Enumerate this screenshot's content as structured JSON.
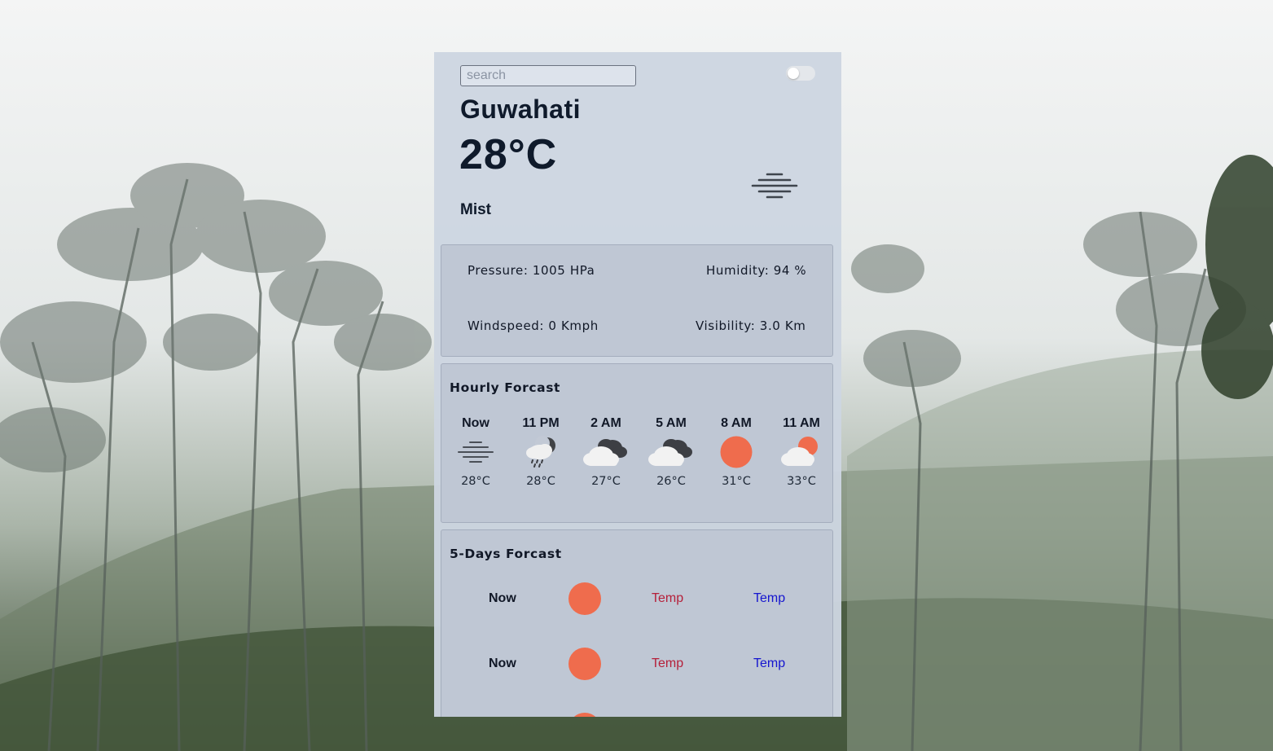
{
  "search": {
    "placeholder": "search"
  },
  "current": {
    "city": "Guwahati",
    "temperature": "28°C",
    "condition": "Mist",
    "icon": "mist-icon"
  },
  "details": {
    "pressure": "Pressure: 1005 HPa",
    "humidity": "Humidity: 94 %",
    "windspeed": "Windspeed: 0 Kmph",
    "visibility": "Visibility: 3.0 Km"
  },
  "hourly": {
    "title": "Hourly Forcast",
    "items": [
      {
        "label": "Now",
        "icon": "mist-icon",
        "temp": "28°C"
      },
      {
        "label": "11 PM",
        "icon": "night-rain-icon",
        "temp": "28°C"
      },
      {
        "label": "2 AM",
        "icon": "broken-clouds-icon",
        "temp": "27°C"
      },
      {
        "label": "5 AM",
        "icon": "broken-clouds-icon",
        "temp": "26°C"
      },
      {
        "label": "8 AM",
        "icon": "sun-icon",
        "temp": "31°C"
      },
      {
        "label": "11 AM",
        "icon": "sun-behind-cloud-icon",
        "temp": "33°C"
      }
    ]
  },
  "five_days": {
    "title": "5-Days Forcast",
    "rows": [
      {
        "label": "Now",
        "icon": "sun-icon",
        "max": "Temp",
        "min": "Temp"
      },
      {
        "label": "Now",
        "icon": "sun-icon",
        "max": "Temp",
        "min": "Temp"
      }
    ]
  },
  "colors": {
    "sun": "#ef6c4d",
    "max_temp": "#b5203a",
    "min_temp": "#1515cf",
    "card_bg": "#cdd5e1"
  }
}
